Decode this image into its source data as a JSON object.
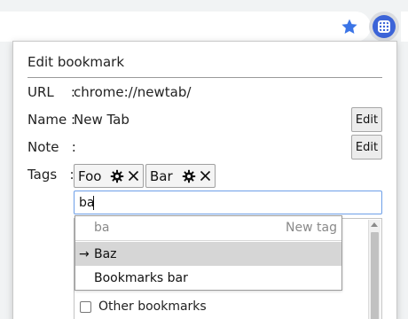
{
  "browser": {
    "star_icon": "star-icon",
    "extension_icon": "hash-icon",
    "accent": "#3c64d8"
  },
  "popup": {
    "title": "Edit bookmark",
    "url": {
      "label": "URL    :",
      "value": "chrome://newtab/"
    },
    "name": {
      "label": "Name :",
      "value": "New Tab",
      "button": "Edit"
    },
    "note": {
      "label": "Note   :",
      "value": "",
      "button": "Edit"
    },
    "tags": {
      "label": "Tags   :",
      "items": [
        {
          "text": "Foo"
        },
        {
          "text": "Bar"
        }
      ],
      "input_value": "ba"
    },
    "dropdown": {
      "query": "ba",
      "new_tag_hint": "New tag",
      "items": [
        {
          "label": "Baz",
          "selected": true
        },
        {
          "label": "Bookmarks bar",
          "selected": false
        }
      ]
    },
    "folders": [
      {
        "label": "Other bookmarks",
        "checked": false
      }
    ]
  }
}
